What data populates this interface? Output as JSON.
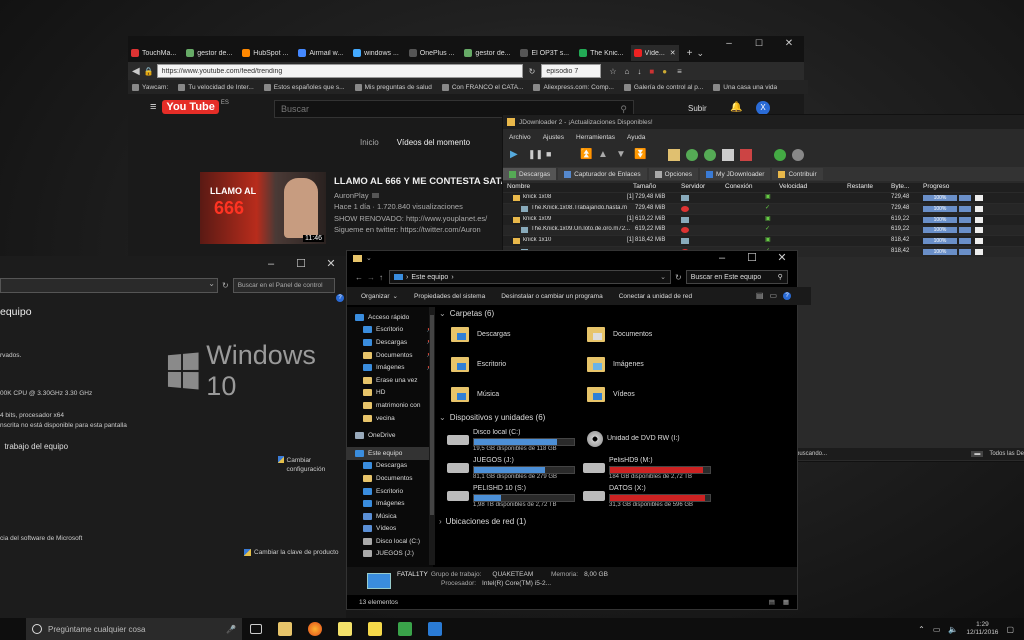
{
  "browser": {
    "tabs": [
      {
        "label": "TouchMa...",
        "color": "#d33"
      },
      {
        "label": "gestor de...",
        "color": "#6a6"
      },
      {
        "label": "HubSpot ...",
        "color": "#f80"
      },
      {
        "label": "Airmail w...",
        "color": "#48f"
      },
      {
        "label": "windows ...",
        "color": "#4af"
      },
      {
        "label": "OnePlus ...",
        "color": "#555"
      },
      {
        "label": "gestor de...",
        "color": "#6a6"
      },
      {
        "label": "El OP3T s...",
        "color": "#555"
      },
      {
        "label": "The Knic...",
        "color": "#2a5"
      },
      {
        "label": "Víde...",
        "color": "#e22"
      }
    ],
    "url": "https://www.youtube.com/feed/trending",
    "search_value": "episodio 7",
    "bookmarks": [
      "Yawcam:",
      "Tu velocidad de Inter...",
      "Estos españoles que s...",
      "Mis preguntas de salud",
      "Con FRANCO el CATA...",
      "Aliexpress.com: Comp...",
      "Galería de control al p...",
      "Una casa una vida"
    ],
    "youtube": {
      "logo": "You Tube",
      "region": "ES",
      "search_placeholder": "Buscar",
      "subir": "Subir",
      "avatar_letter": "X",
      "tabs": [
        "Inicio",
        "Vídeos del momento"
      ],
      "video": {
        "title": "LLAMO AL 666 Y ME CONTESTA SATA",
        "channel": "AuronPlay",
        "meta": "Hace 1 día · 1.720.840 visualizaciones",
        "desc1": "SHOW RENOVADO: http://www.youplanet.es/",
        "desc2": "Sigueme en twitter: https://twitter.com/Auron",
        "duration": "11:46",
        "thumb_text1": "LLAMO AL",
        "thumb_text2": "666"
      }
    }
  },
  "jdownloader": {
    "title": "JDownloader 2 - ¡Actualizaciones Disponibles!",
    "menu": [
      "Archivo",
      "Ajustes",
      "Herramientas",
      "Ayuda"
    ],
    "tabs": [
      "Descargas",
      "Capturador de Enlaces",
      "Opciones",
      "My JDownloader",
      "Contribuir"
    ],
    "columns": [
      "Nombre",
      "Tamaño",
      "Servidor",
      "Conexión",
      "Velocidad",
      "Restante",
      "Byte...",
      "Progreso"
    ],
    "rows": [
      {
        "name": "knick 1x08",
        "count": "[1]",
        "size": "729,48 MiB",
        "bytes": "729,48",
        "progress": "100%",
        "type": "package"
      },
      {
        "name": "The.Knick.1x08.Trabajando.hasta.m",
        "count": "",
        "size": "729,48 MiB",
        "bytes": "729,48",
        "progress": "100%",
        "type": "file"
      },
      {
        "name": "knick 1x09",
        "count": "[1]",
        "size": "619,22 MiB",
        "bytes": "619,22",
        "progress": "100%",
        "type": "package"
      },
      {
        "name": "The.Knick.1x09.Un.loto.de.oro.m72...",
        "count": "",
        "size": "619,22 MiB",
        "bytes": "619,22",
        "progress": "100%",
        "type": "file"
      },
      {
        "name": "knick 1x10",
        "count": "[1]",
        "size": "818,42 MiB",
        "bytes": "818,42",
        "progress": "100%",
        "type": "package"
      },
      {
        "name": "",
        "count": "",
        "size": "",
        "bytes": "818,42",
        "progress": "100%",
        "type": "file"
      }
    ],
    "status_left": "buscando...",
    "status_right": "Todos las De"
  },
  "control_panel": {
    "search_placeholder": "Buscar en el Panel de control",
    "heading": "equipo",
    "reserved": "rvados.",
    "windows_brand": "Windows 10",
    "cpu": "00K CPU @ 3.30GHz   3.30 GHz",
    "system_type": "4 bits, procesador x64",
    "pen": "nscrita no está disponible para esta pantalla",
    "workgroup": "trabajo del equipo",
    "change_config": "Cambiar configuración",
    "license": "cia del software de Microsoft",
    "change_key": "Cambiar la clave de producto"
  },
  "explorer": {
    "address": "Este equipo",
    "search_placeholder": "Buscar en Este equipo",
    "commands": [
      "Organizar",
      "Propiedades del sistema",
      "Desinstalar o cambiar un programa",
      "Conectar a unidad de red"
    ],
    "nav": [
      {
        "label": "Acceso rápido",
        "pin": false,
        "level": 0
      },
      {
        "label": "Escritorio",
        "pin": true,
        "level": 1
      },
      {
        "label": "Descargas",
        "pin": true,
        "level": 1
      },
      {
        "label": "Documentos",
        "pin": true,
        "level": 1
      },
      {
        "label": "Imágenes",
        "pin": true,
        "level": 1
      },
      {
        "label": "Erase una vez",
        "pin": false,
        "level": 1
      },
      {
        "label": "HD",
        "pin": false,
        "level": 1
      },
      {
        "label": "matrimonio con",
        "pin": false,
        "level": 1
      },
      {
        "label": "vecina",
        "pin": false,
        "level": 1
      },
      {
        "label": "OneDrive",
        "pin": false,
        "level": 0
      },
      {
        "label": "Este equipo",
        "pin": false,
        "level": 0
      },
      {
        "label": "Descargas",
        "pin": false,
        "level": 1
      },
      {
        "label": "Documentos",
        "pin": false,
        "level": 1
      },
      {
        "label": "Escritorio",
        "pin": false,
        "level": 1
      },
      {
        "label": "Imágenes",
        "pin": false,
        "level": 1
      },
      {
        "label": "Música",
        "pin": false,
        "level": 1
      },
      {
        "label": "Vídeos",
        "pin": false,
        "level": 1
      },
      {
        "label": "Disco local (C:)",
        "pin": false,
        "level": 1
      },
      {
        "label": "JUEGOS (J:)",
        "pin": false,
        "level": 1
      }
    ],
    "folders_header": "Carpetas (6)",
    "folders": [
      "Descargas",
      "Documentos",
      "Escritorio",
      "Imágenes",
      "Música",
      "Vídeos"
    ],
    "devices_header": "Dispositivos y unidades (6)",
    "drives": [
      {
        "name": "Disco local (C:)",
        "free": "19,5 GB disponibles de 118 GB",
        "used": 0.83,
        "full": false
      },
      {
        "name": "Unidad de DVD RW (I:)",
        "free": "",
        "used": 0,
        "full": false,
        "dvd": true
      },
      {
        "name": "JUEGOS (J:)",
        "free": "81,1 GB disponibles de 279 GB",
        "used": 0.71,
        "full": false
      },
      {
        "name": "PelisHD9 (M:)",
        "free": "184 GB disponibles de 2,72 TB",
        "used": 0.93,
        "full": true
      },
      {
        "name": "PELISHD 10 (S:)",
        "free": "1,98 TB disponibles de 2,72 TB",
        "used": 0.27,
        "full": false
      },
      {
        "name": "DATOS (X:)",
        "free": "31,3 GB disponibles de 596 GB",
        "used": 0.95,
        "full": true
      }
    ],
    "network_header": "Ubicaciones de red (1)",
    "detail": {
      "computer": "FATAL1TY",
      "workgroup_label": "Grupo de trabajo:",
      "workgroup": "QUAKETEAM",
      "memory_label": "Memoria:",
      "memory": "8,00 GB",
      "processor_label": "Procesador:",
      "processor": "Intel(R) Core(TM) i5-2..."
    },
    "status": "13 elementos"
  },
  "taskbar": {
    "cortana_placeholder": "Pregúntame cualquier cosa",
    "time": "1:29",
    "date": "12/11/2016"
  }
}
